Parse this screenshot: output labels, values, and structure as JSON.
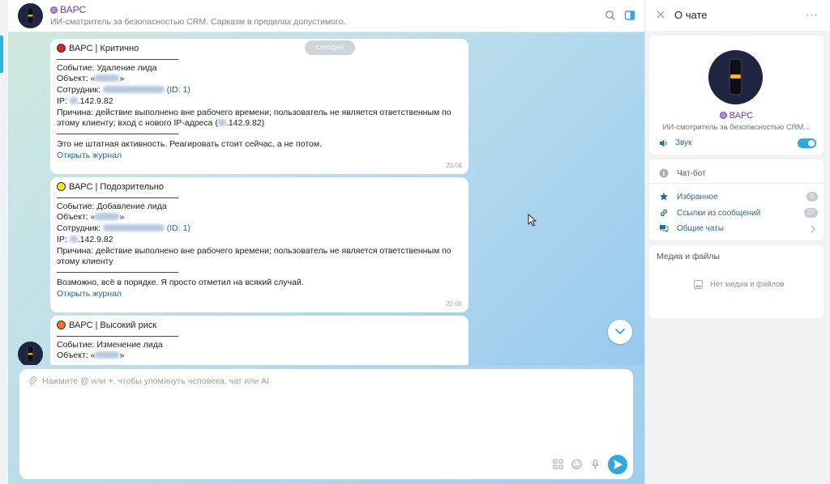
{
  "header": {
    "title": "ВАРС",
    "subtitle": "ИИ-смотритель за безопасностью CRM. Сарказм в пределах допустимого."
  },
  "date_label": "сегодня",
  "messages": [
    {
      "level_color": "#e02424",
      "heading": "ВАРС | Критично",
      "event": "Событие: Удаление лида",
      "object_prefix": "Объект: «",
      "object_suffix": "»",
      "employee_prefix": "Сотрудник: ",
      "employee_id": "(ID: 1)",
      "ip_prefix": "IP: ",
      "ip_suffix": ".142.9.82",
      "reason": "Причина: действие выполнено вне рабочего времени; пользователь не является ответственным по этому клиенту; вход с нового IP-адреса (",
      "reason_ip_suffix": ".142.9.82)",
      "comment": "Это не штатная активность. Реагировать стоит сейчас, а не потом.",
      "link": "Открыть журнал",
      "time": "20:08"
    },
    {
      "level_color": "#f2e22a",
      "heading": "ВАРС | Подозрительно",
      "event": "Событие: Добавление лида",
      "object_prefix": "Объект: «",
      "object_suffix": "»",
      "employee_prefix": "Сотрудник: ",
      "employee_id": "(ID: 1)",
      "ip_prefix": "IP: ",
      "ip_suffix": ".142.9.82",
      "reason": "Причина: действие выполнено вне рабочего времени; пользователь не является ответственным по этому клиенту",
      "comment": "Возможно, всё в порядке. Я просто отметил на всякий случай.",
      "link": "Открыть журнал",
      "time": "20:08"
    },
    {
      "level_color": "#f0751f",
      "heading": "ВАРС | Высокий риск",
      "event": "Событие: Изменение лида",
      "object_prefix": "Объект: «",
      "object_suffix": "»"
    }
  ],
  "composer": {
    "placeholder": "Нажмите @ или +, чтобы упомянуть человека, чат или AI"
  },
  "right_panel": {
    "title": "О чате",
    "more": "···",
    "bot_name": "ВАРС",
    "bot_desc": "ИИ-смотритель за безопасностью CRM...",
    "sound_label": "Звук",
    "sound_on": true,
    "chat_type": "Чат-бот",
    "items": [
      {
        "label": "Избранное",
        "badge": "0"
      },
      {
        "label": "Ссылки из сообщений",
        "badge": "27"
      },
      {
        "label": "Общие чаты",
        "badge": ""
      }
    ],
    "media_title": "Медиа и файлы",
    "media_empty": "Нет медиа и файлов"
  },
  "colors": {
    "accent": "#2fa8e0",
    "bot_name": "#6a3bb0",
    "link": "#2a64a8"
  }
}
